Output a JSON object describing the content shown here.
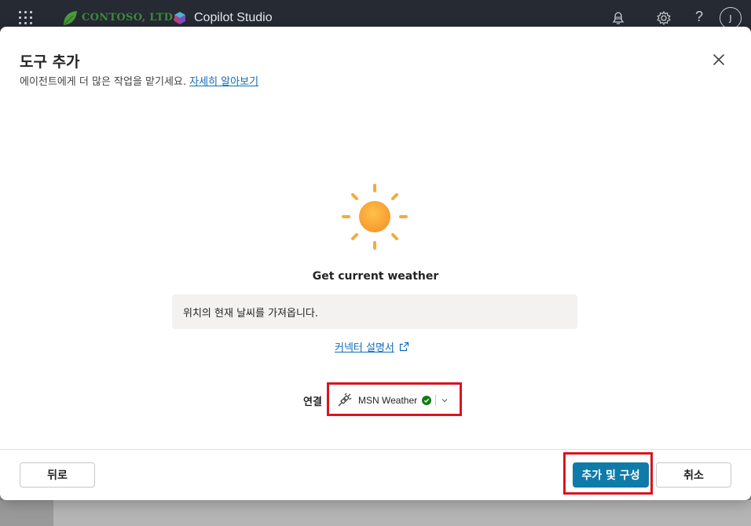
{
  "app": {
    "org_name": "CONTOSO, LTD.",
    "product_name": "Copilot Studio",
    "avatar_initial": "J",
    "help_glyph": "?",
    "icons": [
      "app-launcher-icon",
      "copilot-studio-logo-icon",
      "notifications-icon",
      "settings-gear-icon",
      "help-icon"
    ]
  },
  "dialog": {
    "title": "도구 추가",
    "subtitle": "에이전트에게 더 많은 작업을 맡기세요.",
    "learn_more": "자세히 알아보기",
    "tool_name": "Get current weather",
    "tool_description": "위치의 현재 날씨를 가져옵니다.",
    "connector_doc_link": "커넥터 설명서",
    "connection_label": "연결",
    "connection_value": "MSN Weather",
    "connection_status": "connected",
    "buttons": {
      "back": "뒤로",
      "add_and_configure": "추가 및 구성",
      "cancel": "취소"
    }
  },
  "colors": {
    "topbar": "#252a33",
    "primary": "#0f7ba8",
    "link": "#0f6cbd",
    "highlight": "#d9141e",
    "sun": "#f7a93b",
    "status_ok": "#107c10"
  }
}
